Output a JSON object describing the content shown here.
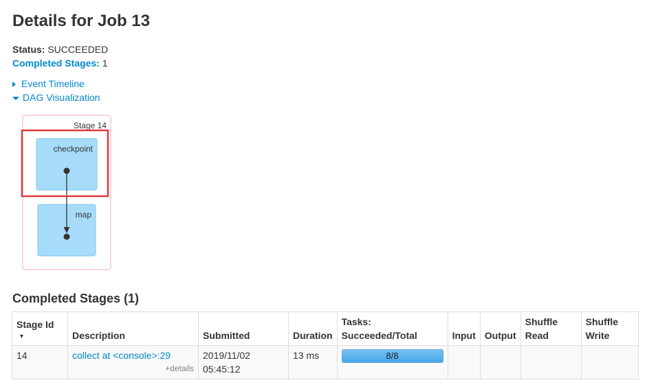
{
  "page": {
    "title": "Details for Job 13"
  },
  "status": {
    "label": "Status:",
    "value": "SUCCEEDED"
  },
  "completed_stages_summary": {
    "label": "Completed Stages:",
    "value": "1"
  },
  "toggles": {
    "event_timeline": "Event Timeline",
    "dag_visualization": "DAG Visualization"
  },
  "dag": {
    "stage_label": "Stage 14",
    "nodes": [
      {
        "label": "checkpoint"
      },
      {
        "label": "map"
      }
    ],
    "colors": {
      "cluster_border": "#f4a9c2",
      "node_fill": "#a6dcf9",
      "node_border": "#79c6ef",
      "highlight": "#e0393e"
    }
  },
  "completed_stages": {
    "title": "Completed Stages (1)",
    "headers": {
      "stage_id": "Stage Id",
      "sort_indicator": "▾",
      "description": "Description",
      "submitted": "Submitted",
      "duration": "Duration",
      "tasks_line1": "Tasks:",
      "tasks_line2": "Succeeded/Total",
      "input": "Input",
      "output": "Output",
      "shuffle_read_1": "Shuffle",
      "shuffle_read_2": "Read",
      "shuffle_write_1": "Shuffle",
      "shuffle_write_2": "Write"
    },
    "rows": [
      {
        "stage_id": "14",
        "description": "collect at <console>:29",
        "details": "+details",
        "submitted_date": "2019/11/02",
        "submitted_time": "05:45:12",
        "duration": "13 ms",
        "tasks_text": "8/8",
        "tasks_fraction": 1.0,
        "input": "",
        "output": "",
        "shuffle_read": "",
        "shuffle_write": ""
      }
    ]
  }
}
